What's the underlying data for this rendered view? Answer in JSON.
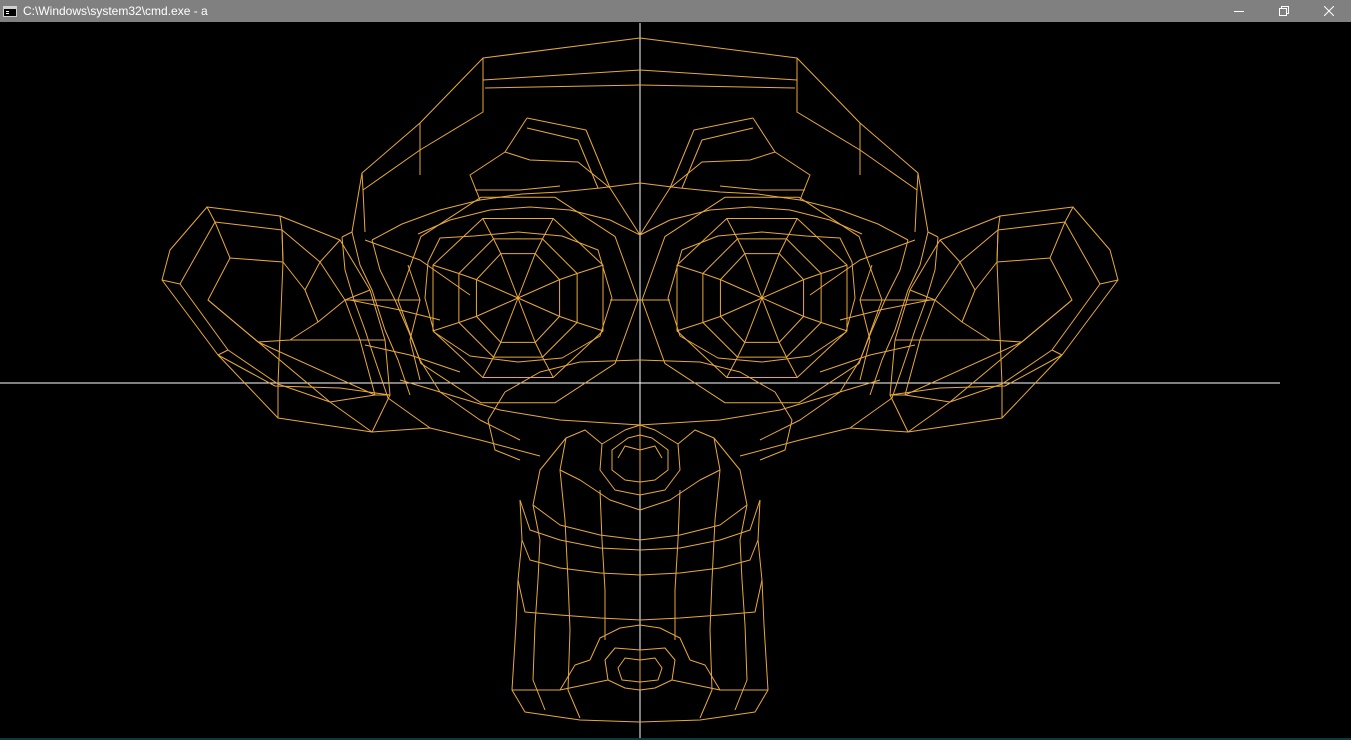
{
  "window": {
    "title": "C:\\Windows\\system32\\cmd.exe - a",
    "icon": "console-icon",
    "controls": {
      "minimize": "minimize-icon",
      "restore": "restore-icon",
      "close": "close-icon"
    }
  },
  "render": {
    "wire_color": "#e8a93a",
    "axis_color": "#ffffff",
    "background": "#000000",
    "titlebar_color": "#808080"
  }
}
